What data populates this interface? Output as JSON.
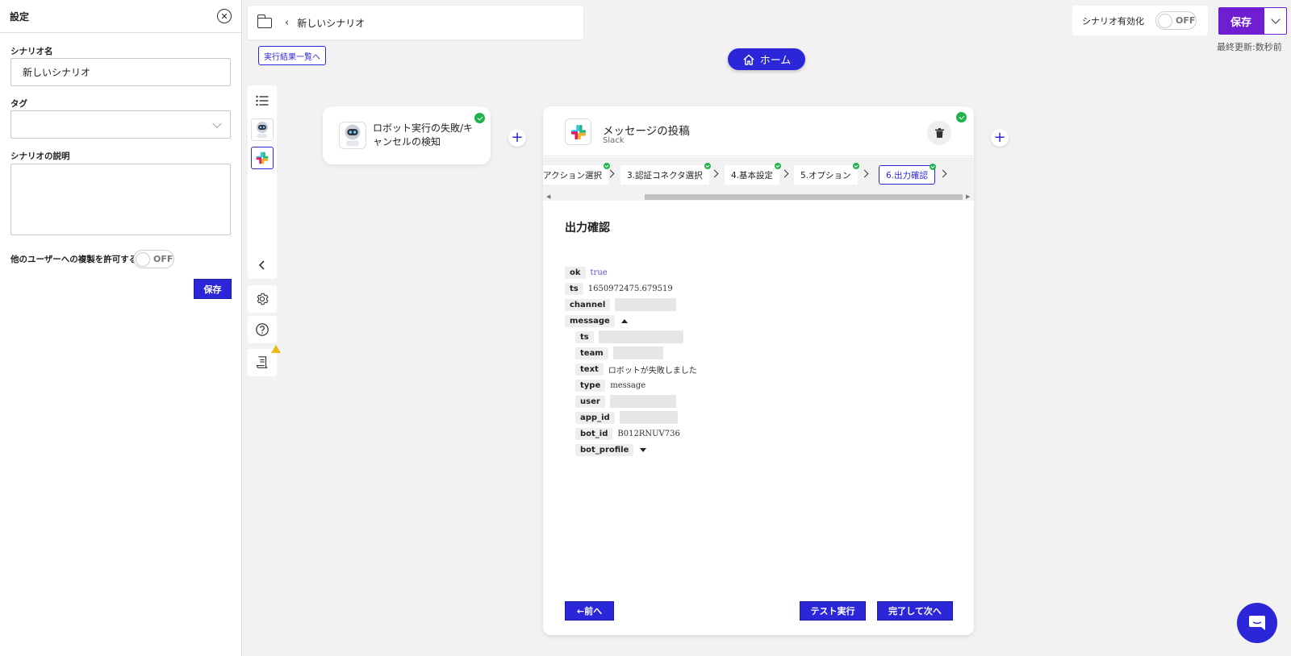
{
  "settings": {
    "title": "設定",
    "scenario_name_label": "シナリオ名",
    "scenario_name_value": "新しいシナリオ",
    "tag_label": "タグ",
    "tag_value": "",
    "description_label": "シナリオの説明",
    "description_value": "",
    "allow_copy_label": "他のユーザーへの複製を許可する",
    "allow_copy_toggle": "OFF",
    "save_label": "保存"
  },
  "topbar": {
    "scenario_title": "新しいシナリオ",
    "results_link": "実行結果一覧へ",
    "home_label": "ホーム",
    "enable_label": "シナリオ有効化",
    "enable_toggle": "OFF",
    "save_label": "保存",
    "last_updated": "最終更新:数秒前"
  },
  "trigger_node": {
    "label": "ロボット実行の失敗/キャンセルの検知"
  },
  "action_card": {
    "title": "メッセージの投稿",
    "service": "Slack",
    "steps": [
      {
        "label": "アクション選択"
      },
      {
        "label": "3.認証コネクタ選択"
      },
      {
        "label": "4.基本設定"
      },
      {
        "label": "5.オプション"
      },
      {
        "label": "6.出力確認"
      }
    ],
    "output_title": "出力確認",
    "output": {
      "ok": {
        "key": "ok",
        "value": "true"
      },
      "ts": {
        "key": "ts",
        "value": "1650972475.679519"
      },
      "channel": {
        "key": "channel"
      },
      "message": {
        "key": "message"
      },
      "m_ts": {
        "key": "ts"
      },
      "m_team": {
        "key": "team"
      },
      "m_text": {
        "key": "text",
        "value": "ロボットが失敗しました"
      },
      "m_type": {
        "key": "type",
        "value": "message"
      },
      "m_user": {
        "key": "user"
      },
      "m_app_id": {
        "key": "app_id"
      },
      "m_bot_id": {
        "key": "bot_id",
        "value": "B012RNUV736"
      },
      "m_bot_profile": {
        "key": "bot_profile"
      }
    },
    "prev_label": "←前へ",
    "test_label": "テスト実行",
    "next_label": "完了して次へ"
  },
  "colors": {
    "primary": "#2b27d8",
    "save_purple": "#6f1fd1",
    "success": "#22b24c",
    "warning": "#f0b71c"
  }
}
